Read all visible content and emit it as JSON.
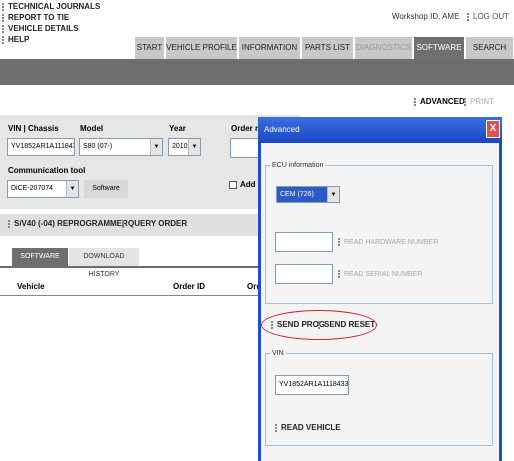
{
  "top_links": [
    "TECHNICAL JOURNALS",
    "REPORT TO TIE",
    "VEHICLE DETAILS",
    "HELP"
  ],
  "header": {
    "workshop": "Workshop ID, AME",
    "logout": "LOG OUT"
  },
  "tabs": [
    {
      "label": "START",
      "state": "normal"
    },
    {
      "label": "VEHICLE PROFILE",
      "state": "normal"
    },
    {
      "label": "INFORMATION",
      "state": "normal"
    },
    {
      "label": "PARTS LIST",
      "state": "normal"
    },
    {
      "label": "DIAGNOSTICS",
      "state": "disabled"
    },
    {
      "label": "SOFTWARE",
      "state": "active"
    },
    {
      "label": "SEARCH",
      "state": "normal"
    }
  ],
  "toolbar": {
    "advanced": "ADVANCED",
    "print": "PRINT"
  },
  "form": {
    "vin_label": "VIN | Chassis",
    "vin_value": "YV1852AR1A1118433",
    "model_label": "Model",
    "model_value": "S80 (07-)",
    "year_label": "Year",
    "year_value": "2010",
    "order_label": "Order re",
    "comm_label": "Communication tool",
    "comm_value": "DiCE-207074",
    "software_button": "Software",
    "add_label": "Add to"
  },
  "actions": {
    "reprogrammer": "S/V40 (-04) REPROGRAMMER",
    "query_order": "QUERY ORDER"
  },
  "subtabs": {
    "software_list": "SOFTWARE LIST",
    "download_history": "DOWNLOAD HISTORY"
  },
  "table": {
    "headers": [
      "Vehicle",
      "Order ID",
      "Ord"
    ]
  },
  "dialog": {
    "title": "Advanced",
    "close": "X",
    "ecu_legend": "ECU information",
    "ecu_value": "CEM (726)",
    "read_hw": "READ HARDWARE NUMBER",
    "read_serial": "READ SERIAL NUMBER",
    "send_prog": "SEND PROG",
    "send_reset": "SEND RESET",
    "vin_legend": "VIN",
    "vin_value": "YV1852AR1A1118433",
    "read_vehicle": "READ VEHICLE"
  },
  "colors": {
    "accent": "#1b4fcf",
    "title_bar": "#1947c4",
    "close_button": "#d9534f",
    "grey_bar": "#6e6e6e",
    "highlight_ellipse": "#c0282d"
  }
}
